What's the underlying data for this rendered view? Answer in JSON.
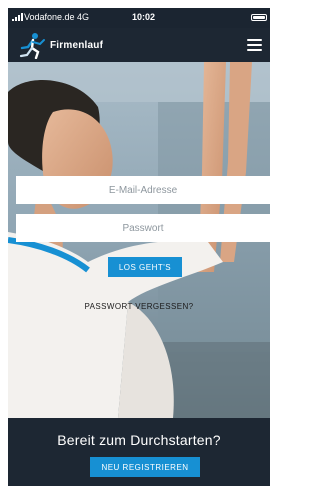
{
  "status_bar": {
    "carrier": "Vodafone.de  4G",
    "time": "10:02"
  },
  "header": {
    "logo_text_prefix": "",
    "logo_text": "Firmenlauf",
    "logo_icon": "running-person-icon",
    "menu_icon": "hamburger-menu-icon"
  },
  "login_form": {
    "email_placeholder": "E-Mail-Adresse",
    "password_placeholder": "Passwort",
    "submit_label": "LOS GEHT'S",
    "forgot_password_label": "PASSWORT VERGESSEN?"
  },
  "footer": {
    "title": "Bereit zum Durchstarten?",
    "register_label": "NEU REGISTRIEREN"
  },
  "colors": {
    "header_bg": "#1d2733",
    "accent": "#1790d3",
    "text_on_dark": "#ffffff"
  }
}
